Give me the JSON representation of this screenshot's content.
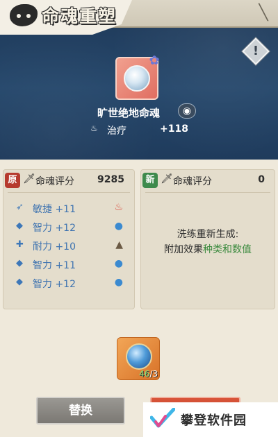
{
  "header": {
    "title": "命魂重塑",
    "info_glyph": "!"
  },
  "soul": {
    "name": "旷世绝地命魂",
    "stat_icon": "heal-icon",
    "stat_name": "治疗",
    "stat_value": "+118"
  },
  "original_panel": {
    "seal": "原",
    "score_label": "命魂评分",
    "score": "9285",
    "attributes": [
      {
        "icon": "agility-icon",
        "label": "敏捷 +11",
        "element": "fire"
      },
      {
        "icon": "intellect-icon",
        "label": "智力 +12",
        "element": "water"
      },
      {
        "icon": "stamina-icon",
        "label": "耐力 +10",
        "element": "earth"
      },
      {
        "icon": "intellect-icon",
        "label": "智力 +11",
        "element": "water"
      },
      {
        "icon": "intellect-icon",
        "label": "智力 +12",
        "element": "water"
      }
    ]
  },
  "new_panel": {
    "seal": "新",
    "score_label": "命魂评分",
    "score": "0",
    "line1": "洗练重新生成:",
    "line2_prefix": "附加效果",
    "line2_highlight": "种类和数值"
  },
  "material": {
    "owned": "46",
    "required": "/3"
  },
  "buttons": {
    "replace": "替换"
  },
  "watermark": {
    "text": "攀登软件园"
  },
  "colors": {
    "banner": "#26486c",
    "attribute_text": "#3e73b0",
    "highlight_green": "#3b8a3e",
    "reroll_button": "#b8381f"
  }
}
